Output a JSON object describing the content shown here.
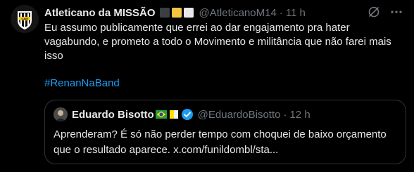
{
  "tweet": {
    "author_name": "Atleticano da MISSÃO",
    "handle": "@AtleticanoM14",
    "dot": "·",
    "time": "11 h",
    "text": "Eu assumo publicamente que errei ao dar engajamento pra hater vagabundo, e prometo a todo o Movimento e militância que não farei mais isso",
    "hashtag": "#RenanNaBand"
  },
  "quote": {
    "author_name": "Eduardo Bisotto",
    "handle": "@EduardoBisotto",
    "dot": "·",
    "time": "12 h",
    "text": "Aprenderam? É só não perder tempo com choquei de baixo orçamento que o resultado aparece. x.com/funildombl/sta..."
  },
  "colors": {
    "background": "#000000",
    "text": "#e7e9ea",
    "muted": "#71767b",
    "link": "#1d9bf0",
    "border": "#2f3336",
    "verified": "#1d9bf0"
  },
  "icons": [
    "club-crest-icon",
    "grok-icon",
    "more-icon",
    "verified-badge-icon",
    "brazil-flag-icon",
    "vatican-flag-icon"
  ]
}
